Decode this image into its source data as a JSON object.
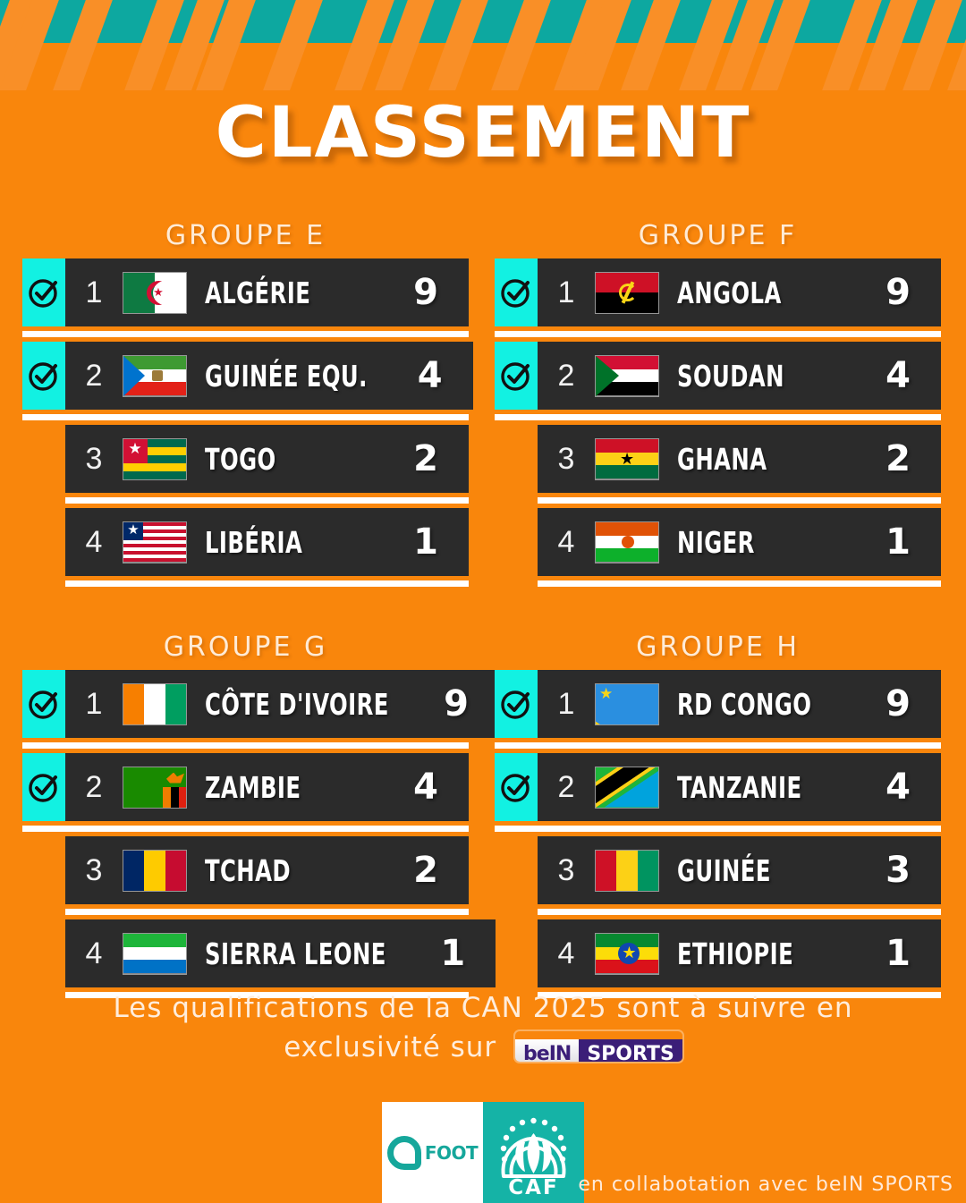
{
  "theme": {
    "orange": "#F9860C",
    "teal_band": "#0DA8A0",
    "cyan_tab": "#12F1E2",
    "row_dark": "#2B2B2B",
    "divider_white": "#FFFFFF",
    "caf_teal": "#15B3A6"
  },
  "header": {
    "title": "CLASSEMENT"
  },
  "groups": [
    {
      "title": "GROUPE E",
      "rows": [
        {
          "rank": "1",
          "country": "ALGÉRIE",
          "points": "9",
          "qualified": true,
          "flag": "algeria"
        },
        {
          "rank": "2",
          "country": "GUINÉE EQU.",
          "points": "4",
          "qualified": true,
          "flag": "equatorial-guinea"
        },
        {
          "rank": "3",
          "country": "TOGO",
          "points": "2",
          "qualified": false,
          "flag": "togo"
        },
        {
          "rank": "4",
          "country": "LIBÉRIA",
          "points": "1",
          "qualified": false,
          "flag": "liberia"
        }
      ]
    },
    {
      "title": "GROUPE F",
      "rows": [
        {
          "rank": "1",
          "country": "ANGOLA",
          "points": "9",
          "qualified": true,
          "flag": "angola"
        },
        {
          "rank": "2",
          "country": "SOUDAN",
          "points": "4",
          "qualified": true,
          "flag": "sudan"
        },
        {
          "rank": "3",
          "country": "GHANA",
          "points": "2",
          "qualified": false,
          "flag": "ghana"
        },
        {
          "rank": "4",
          "country": "NIGER",
          "points": "1",
          "qualified": false,
          "flag": "niger"
        }
      ]
    },
    {
      "title": "GROUPE G",
      "rows": [
        {
          "rank": "1",
          "country": "CÔTE D'IVOIRE",
          "points": "9",
          "qualified": true,
          "flag": "ivory-coast"
        },
        {
          "rank": "2",
          "country": "ZAMBIE",
          "points": "4",
          "qualified": true,
          "flag": "zambia"
        },
        {
          "rank": "3",
          "country": "TCHAD",
          "points": "2",
          "qualified": false,
          "flag": "chad"
        },
        {
          "rank": "4",
          "country": "SIERRA LEONE",
          "points": "1",
          "qualified": false,
          "flag": "sierra-leone"
        }
      ]
    },
    {
      "title": "GROUPE H",
      "rows": [
        {
          "rank": "1",
          "country": "RD CONGO",
          "points": "9",
          "qualified": true,
          "flag": "dr-congo"
        },
        {
          "rank": "2",
          "country": "TANZANIE",
          "points": "4",
          "qualified": true,
          "flag": "tanzania"
        },
        {
          "rank": "3",
          "country": "GUINÉE",
          "points": "3",
          "qualified": false,
          "flag": "guinea"
        },
        {
          "rank": "4",
          "country": "ETHIOPIE",
          "points": "1",
          "qualified": false,
          "flag": "ethiopia"
        }
      ]
    }
  ],
  "footer": {
    "line1": "Les qualifications de la CAN 2025 sont à suivre en",
    "line2": "exclusivité sur",
    "bein_part1": "beIN",
    "bein_part2": "SPORTS"
  },
  "logos": {
    "afoot_text": "FOOT",
    "caf_text": "CAF"
  },
  "collaboration": "en collabotation avec beIN SPORTS"
}
